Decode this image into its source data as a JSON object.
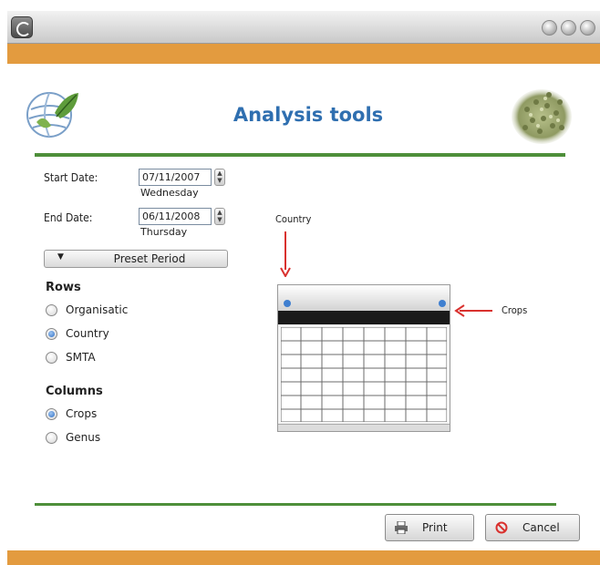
{
  "header": {
    "title": "Analysis tools",
    "logo_icon": "globe-leaf-logo",
    "seed_image": "seeds-photo"
  },
  "dates": {
    "start_label": "Start Date:",
    "start_value": "07/11/2007",
    "start_day": "Wednesday",
    "end_label": "End Date:",
    "end_value": "06/11/2008",
    "end_day": "Thursday"
  },
  "preset": {
    "label": "Preset Period",
    "icon": "triangle-down-icon"
  },
  "rows": {
    "title": "Rows",
    "options": [
      {
        "label": "Organisatic",
        "selected": false
      },
      {
        "label": "Country",
        "selected": true
      },
      {
        "label": "SMTA",
        "selected": false
      }
    ]
  },
  "columns": {
    "title": "Columns",
    "options": [
      {
        "label": "Crops",
        "selected": true
      },
      {
        "label": "Genus",
        "selected": false
      }
    ]
  },
  "diagram": {
    "row_axis_label": "Country",
    "column_axis_label": "Crops"
  },
  "buttons": {
    "print": "Print",
    "cancel": "Cancel"
  },
  "colors": {
    "accent_orange": "#e39b3f",
    "divider_green": "#4e8f3a",
    "title_blue": "#2f6fb0",
    "arrow_red": "#d9312e"
  }
}
